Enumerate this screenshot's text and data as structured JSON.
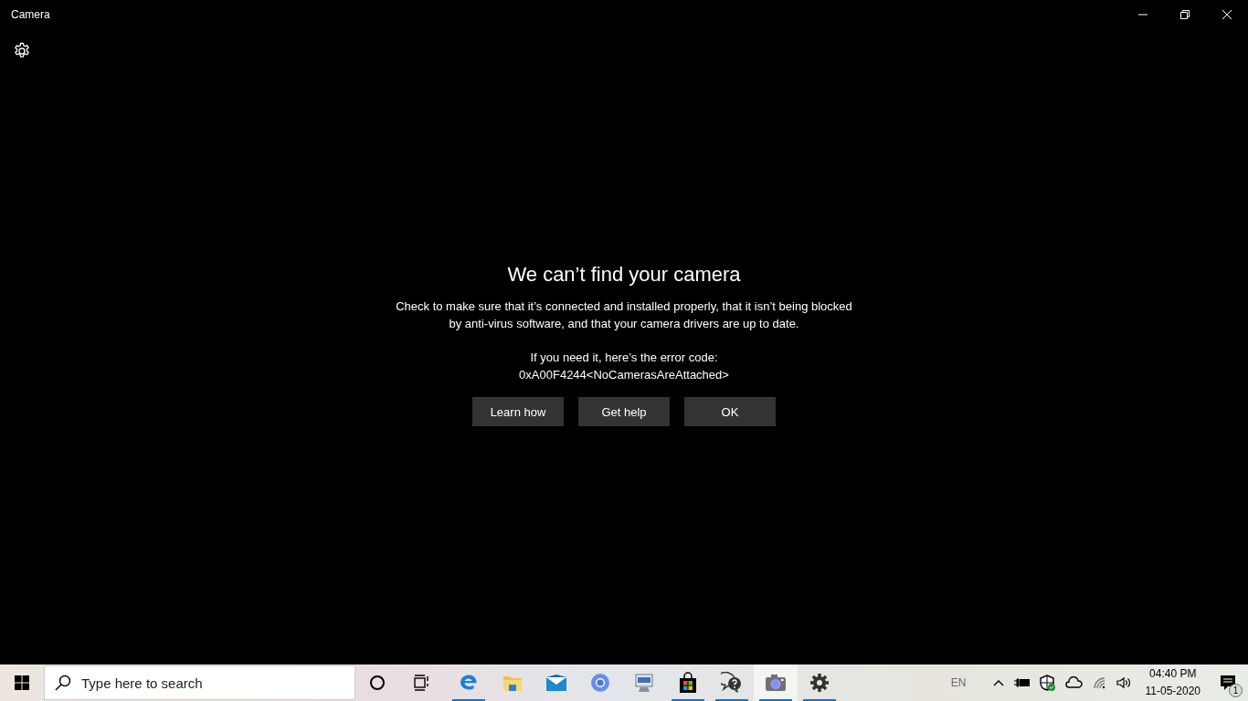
{
  "window": {
    "title": "Camera"
  },
  "dialog": {
    "heading": "We can’t find your camera",
    "message": "Check to make sure that it’s connected and installed properly, that it isn’t being blocked by anti-virus software, and that your camera drivers are up to date.",
    "error_intro": "If you need it, here’s the error code:",
    "error_code": "0xA00F4244<NoCamerasAreAttached>",
    "buttons": [
      "Learn how",
      "Get help",
      "OK"
    ]
  },
  "taskbar": {
    "search": {
      "placeholder": "Type here to search"
    },
    "apps": [
      {
        "kind": "edge",
        "running": true,
        "selected": false
      },
      {
        "kind": "folder",
        "running": false,
        "selected": false
      },
      {
        "kind": "mail",
        "running": false,
        "selected": false
      },
      {
        "kind": "chrome",
        "running": false,
        "selected": false
      },
      {
        "kind": "remote",
        "running": false,
        "selected": false
      },
      {
        "kind": "store",
        "running": true,
        "selected": false
      },
      {
        "kind": "feedback",
        "running": true,
        "selected": false
      },
      {
        "kind": "camera",
        "running": true,
        "selected": true
      },
      {
        "kind": "settings",
        "running": true,
        "selected": false
      }
    ],
    "language": "EN",
    "time": "04:40 PM",
    "date": "11-05-2020",
    "notification_count": "1"
  }
}
